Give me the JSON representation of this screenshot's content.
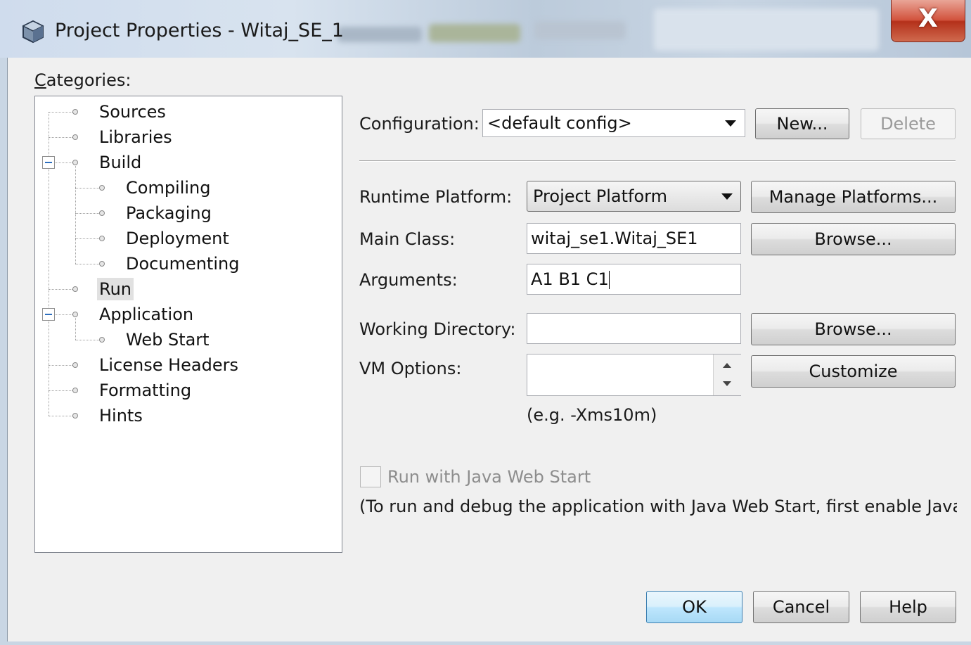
{
  "window": {
    "title": "Project Properties - Witaj_SE_1",
    "close_label": "X",
    "icon": "cube-icon"
  },
  "categories": {
    "label": "Categories:",
    "items": [
      "Sources",
      "Libraries",
      "Build",
      "Compiling",
      "Packaging",
      "Deployment",
      "Documenting",
      "Run",
      "Application",
      "Web Start",
      "License Headers",
      "Formatting",
      "Hints"
    ],
    "selected": "Run"
  },
  "configuration": {
    "label": "Configuration:",
    "value": "<default config>",
    "new_label": "New...",
    "delete_label": "Delete"
  },
  "runtime": {
    "label": "Runtime Platform:",
    "value": "Project Platform",
    "manage_label": "Manage Platforms..."
  },
  "main_class": {
    "label": "Main Class:",
    "value": "witaj_se1.Witaj_SE1",
    "browse_label": "Browse..."
  },
  "arguments": {
    "label": "Arguments:",
    "value": "A1 B1 C1"
  },
  "working_dir": {
    "label": "Working Directory:",
    "value": "",
    "browse_label": "Browse..."
  },
  "vm_options": {
    "label": "VM Options:",
    "value": "",
    "customize_label": "Customize",
    "hint": "(e.g. -Xms10m)"
  },
  "web_start": {
    "label": "Run with Java Web Start",
    "checked": false,
    "note": "(To run and debug the application with Java Web Start, first enable Java V"
  },
  "footer": {
    "ok_label": "OK",
    "cancel_label": "Cancel",
    "help_label": "Help"
  }
}
